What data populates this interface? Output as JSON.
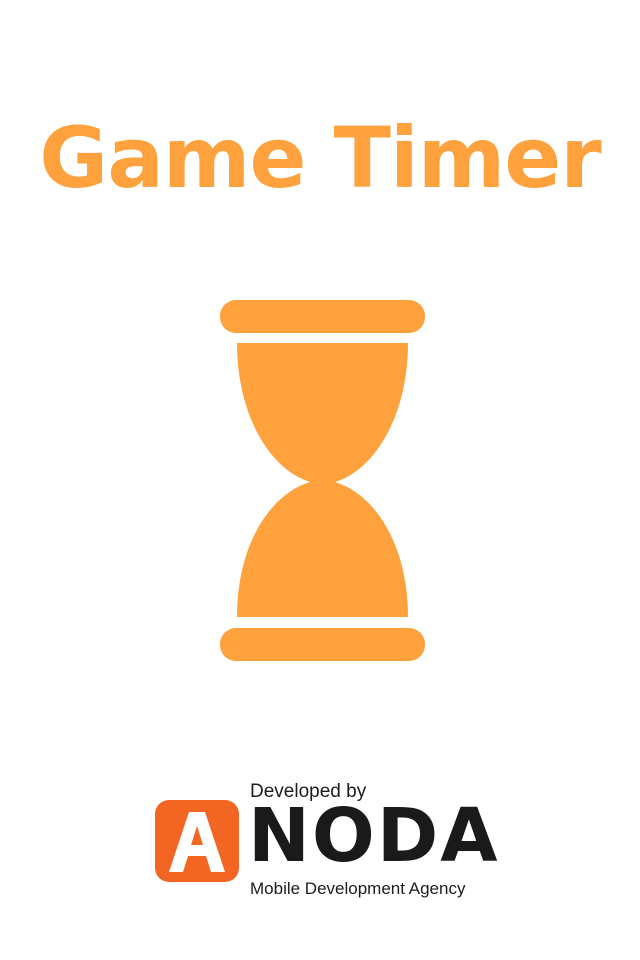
{
  "splash": {
    "title": "Game Timer",
    "icon": "hourglass-icon",
    "accent_color": "#FFA23E"
  },
  "credits": {
    "developed_by": "Developed by",
    "logo_letter": "A",
    "brand": "NODA",
    "tagline": "Mobile Development Agency",
    "brand_color": "#F26522"
  }
}
